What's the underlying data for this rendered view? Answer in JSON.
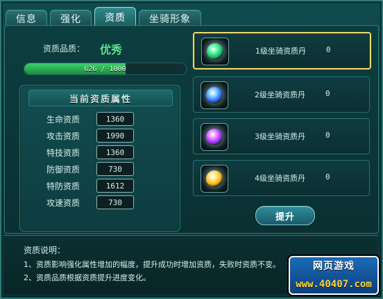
{
  "tabs": [
    {
      "label": "信息"
    },
    {
      "label": "强化"
    },
    {
      "label": "资质",
      "active": true
    },
    {
      "label": "坐骑形象"
    }
  ],
  "quality": {
    "label": "资质品质：",
    "value": "优秀",
    "progress_text": "626 / 1000",
    "progress_current": 626,
    "progress_max": 1000
  },
  "attributes": {
    "title": "当前资质属性",
    "rows": [
      {
        "name": "生命资质",
        "value": "1360"
      },
      {
        "name": "攻击资质",
        "value": "1990"
      },
      {
        "name": "特技资质",
        "value": "1360"
      },
      {
        "name": "防御资质",
        "value": "730"
      },
      {
        "name": "特防资质",
        "value": "1612"
      },
      {
        "name": "攻速资质",
        "value": "730"
      }
    ]
  },
  "items": [
    {
      "name": "1级坐骑资质丹",
      "count": "0",
      "selected": true,
      "icon": "mount-pill-green-icon",
      "color": "#43f08a"
    },
    {
      "name": "2级坐骑资质丹",
      "count": "0",
      "selected": false,
      "icon": "mount-pill-blue-icon",
      "color": "#6fb3ff"
    },
    {
      "name": "3级坐骑资质丹",
      "count": "0",
      "selected": false,
      "icon": "mount-pill-purple-icon",
      "color": "#c55cff"
    },
    {
      "name": "4级坐骑资质丹",
      "count": "0",
      "selected": false,
      "icon": "mount-pill-gold-icon",
      "color": "#ffd35b"
    }
  ],
  "actions": {
    "upgrade_label": "提升"
  },
  "description": {
    "title": "资质说明：",
    "lines": [
      "1、资质影响强化属性增加的幅度，提升成功时增加资质，失败时资质不变。",
      "2、资质品质根据资质提升进度变化。"
    ]
  },
  "watermark": {
    "top": "网页游戏",
    "bottom": "www.40407.com"
  }
}
